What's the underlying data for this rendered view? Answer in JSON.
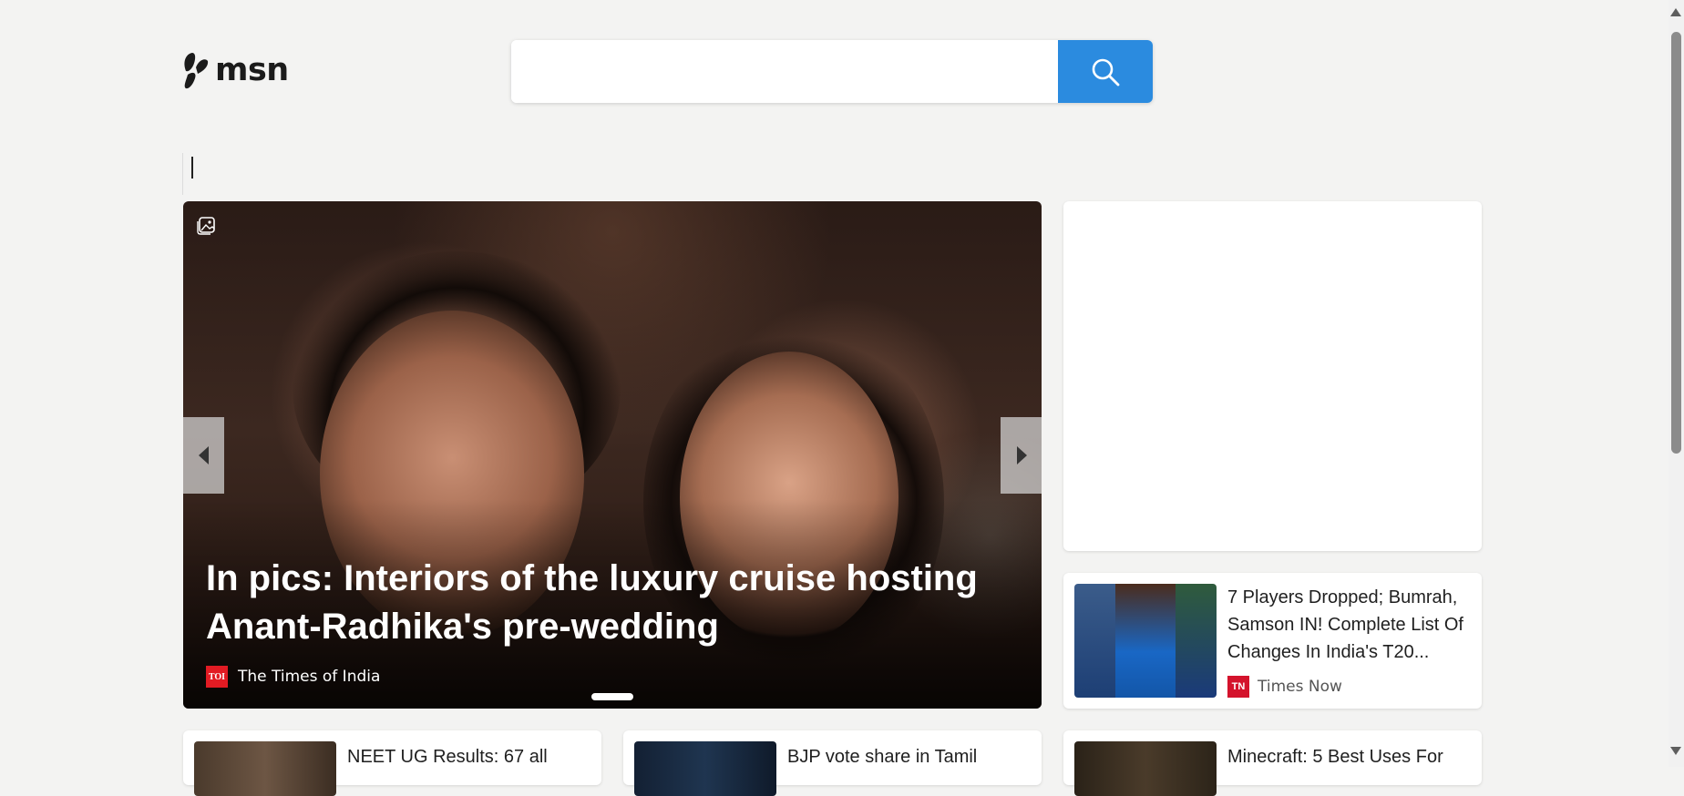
{
  "logo": {
    "text": "msn"
  },
  "search": {
    "value": "",
    "placeholder": ""
  },
  "hero": {
    "title": "In pics: Interiors of the luxury cruise hosting Anant-Radhika's pre-wedding",
    "source": "The Times of India",
    "source_logo": "TOI"
  },
  "sidebar_news": {
    "title": "7 Players Dropped; Bumrah, Samson IN! Complete List Of Changes In India's T20...",
    "source": "Times Now",
    "source_logo": "TN"
  },
  "bottom_cards": [
    {
      "title": "NEET UG Results: 67 all"
    },
    {
      "title": "BJP vote share in Tamil"
    },
    {
      "title": "Minecraft: 5 Best Uses For"
    }
  ],
  "colors": {
    "accent": "#2b8bdf",
    "background": "#f3f3f2"
  }
}
